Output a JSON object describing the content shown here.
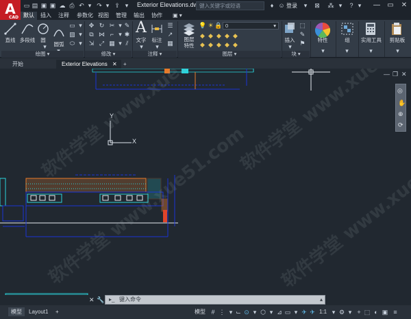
{
  "app": {
    "logo_letter": "A",
    "logo_sub": "CAD"
  },
  "title": {
    "document": "Exterior Elevations.dwg"
  },
  "search": {
    "placeholder": "键入关键字或短语"
  },
  "user": {
    "login_label": "登录"
  },
  "ribbon_tabs": [
    "默认",
    "插入",
    "注释",
    "参数化",
    "视图",
    "管理",
    "输出",
    "协作"
  ],
  "ribbon": {
    "draw": {
      "line": "直线",
      "polyline": "多段线",
      "circle": "圆",
      "arc": "圆弧",
      "title": "绘图 ▾"
    },
    "modify": {
      "title": "修改 ▾"
    },
    "annotation": {
      "text": "文字",
      "dimension": "标注",
      "title": "注释 ▾"
    },
    "layers": {
      "layer_props": "图层\n特性",
      "current_layer": "0",
      "title": "图层 ▾"
    },
    "block": {
      "insert": "插入",
      "title": "块 ▾"
    },
    "properties": {
      "label": "特性"
    },
    "groups": {
      "label": "组"
    },
    "utilities": {
      "label": "实用工具"
    },
    "clipboard": {
      "label": "剪贴板"
    }
  },
  "file_tabs": {
    "start": "开始",
    "current": "Exterior Elevations"
  },
  "ucs": {
    "x_label": "X",
    "y_label": "Y"
  },
  "command": {
    "placeholder": "键入命令"
  },
  "status": {
    "model_tab": "模型",
    "layout_tab": "Layout1",
    "model_btn": "模型",
    "scale": "1:1"
  },
  "watermark": "软件学堂 www.xue51.com",
  "colors": {
    "accent": "#c51d24",
    "canvas": "#212830",
    "cyan": "#2ad4dc",
    "orange": "#e67a2a",
    "blue": "#1a35d6"
  }
}
